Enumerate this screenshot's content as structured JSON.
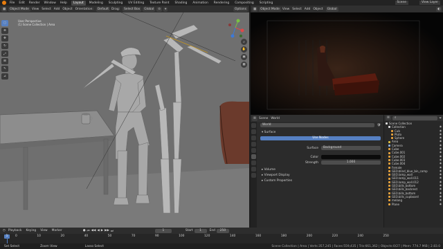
{
  "topbar": {
    "menus": [
      "File",
      "Edit",
      "Render",
      "Window",
      "Help"
    ],
    "tabs": [
      "Layout",
      "Modeling",
      "Sculpting",
      "UV Editing",
      "Texture Paint",
      "Shading",
      "Animation",
      "Rendering",
      "Compositing",
      "Scripting"
    ],
    "active_tab": "Layout",
    "scene": "Scene",
    "view_layer": "View Layer"
  },
  "left_header": {
    "mode": "Object Mode",
    "view": "View",
    "select": "Select",
    "add": "Add",
    "object": "Object",
    "orientation_label": "Orientation:",
    "orientation": "Default",
    "drag_label": "Drag:",
    "drag": "Select Box",
    "global": "Global",
    "options": "Options"
  },
  "viewport": {
    "line1": "User Perspective",
    "line2": "(1) Scene Collection | Area"
  },
  "right_header": {
    "mode": "Object Mode",
    "view": "View",
    "select": "Select",
    "add": "Add",
    "object": "Object",
    "global": "Global"
  },
  "properties": {
    "tab_scene": "Scene",
    "tab_world": "World",
    "world_name": "World",
    "surface_header": "Surface",
    "use_nodes": "Use Nodes",
    "surface_label": "Surface",
    "surface_value": "Background",
    "color_label": "Color",
    "strength_label": "Strength",
    "strength_value": "1.000",
    "sections": [
      "Volume",
      "Viewport Display",
      "Custom Properties"
    ]
  },
  "outliner": {
    "root": "Scene Collection",
    "collection": "Collection",
    "items": [
      "Cub",
      "Pluto",
      "Sphere",
      "Area",
      "Camera",
      "Cube",
      "Cube.001",
      "Cube.002",
      "Cube.003",
      "Cube.004",
      "Female",
      "GEO.blind_blue_bin_comp",
      "GEO.lamp_wall",
      "GEO.lamp_wall.011",
      "GEO.lamp_wall.012",
      "GEO.bills_bottom",
      "GEO.bills_backrest",
      "GEO.bills_bottom",
      "GEO.bills_cupboard",
      "melang",
      "Plane"
    ]
  },
  "timeline": {
    "menus": [
      "Playback",
      "Keying",
      "View",
      "Marker"
    ],
    "current_frame": "1",
    "start_label": "Start",
    "start": "1",
    "end_label": "End",
    "end": "250",
    "ticks": [
      "0",
      "10",
      "20",
      "40",
      "50",
      "70",
      "90",
      "100",
      "120",
      "140",
      "160",
      "180",
      "200",
      "220",
      "240",
      "250"
    ]
  },
  "status": {
    "left1": "Set Select",
    "left2": "Zoom View",
    "left3": "Lasso Select",
    "right": "Scene Collection | Area | Verts:357,245 | Faces:559,435 | Tris:661,362 | Objects:0/27 | Mem: 774.7 MiB | 2.83.0"
  },
  "colors": {
    "accent": "#5680c2",
    "viewport_bg": "#6f6f6f",
    "blender_orange": "#e87d0d"
  }
}
